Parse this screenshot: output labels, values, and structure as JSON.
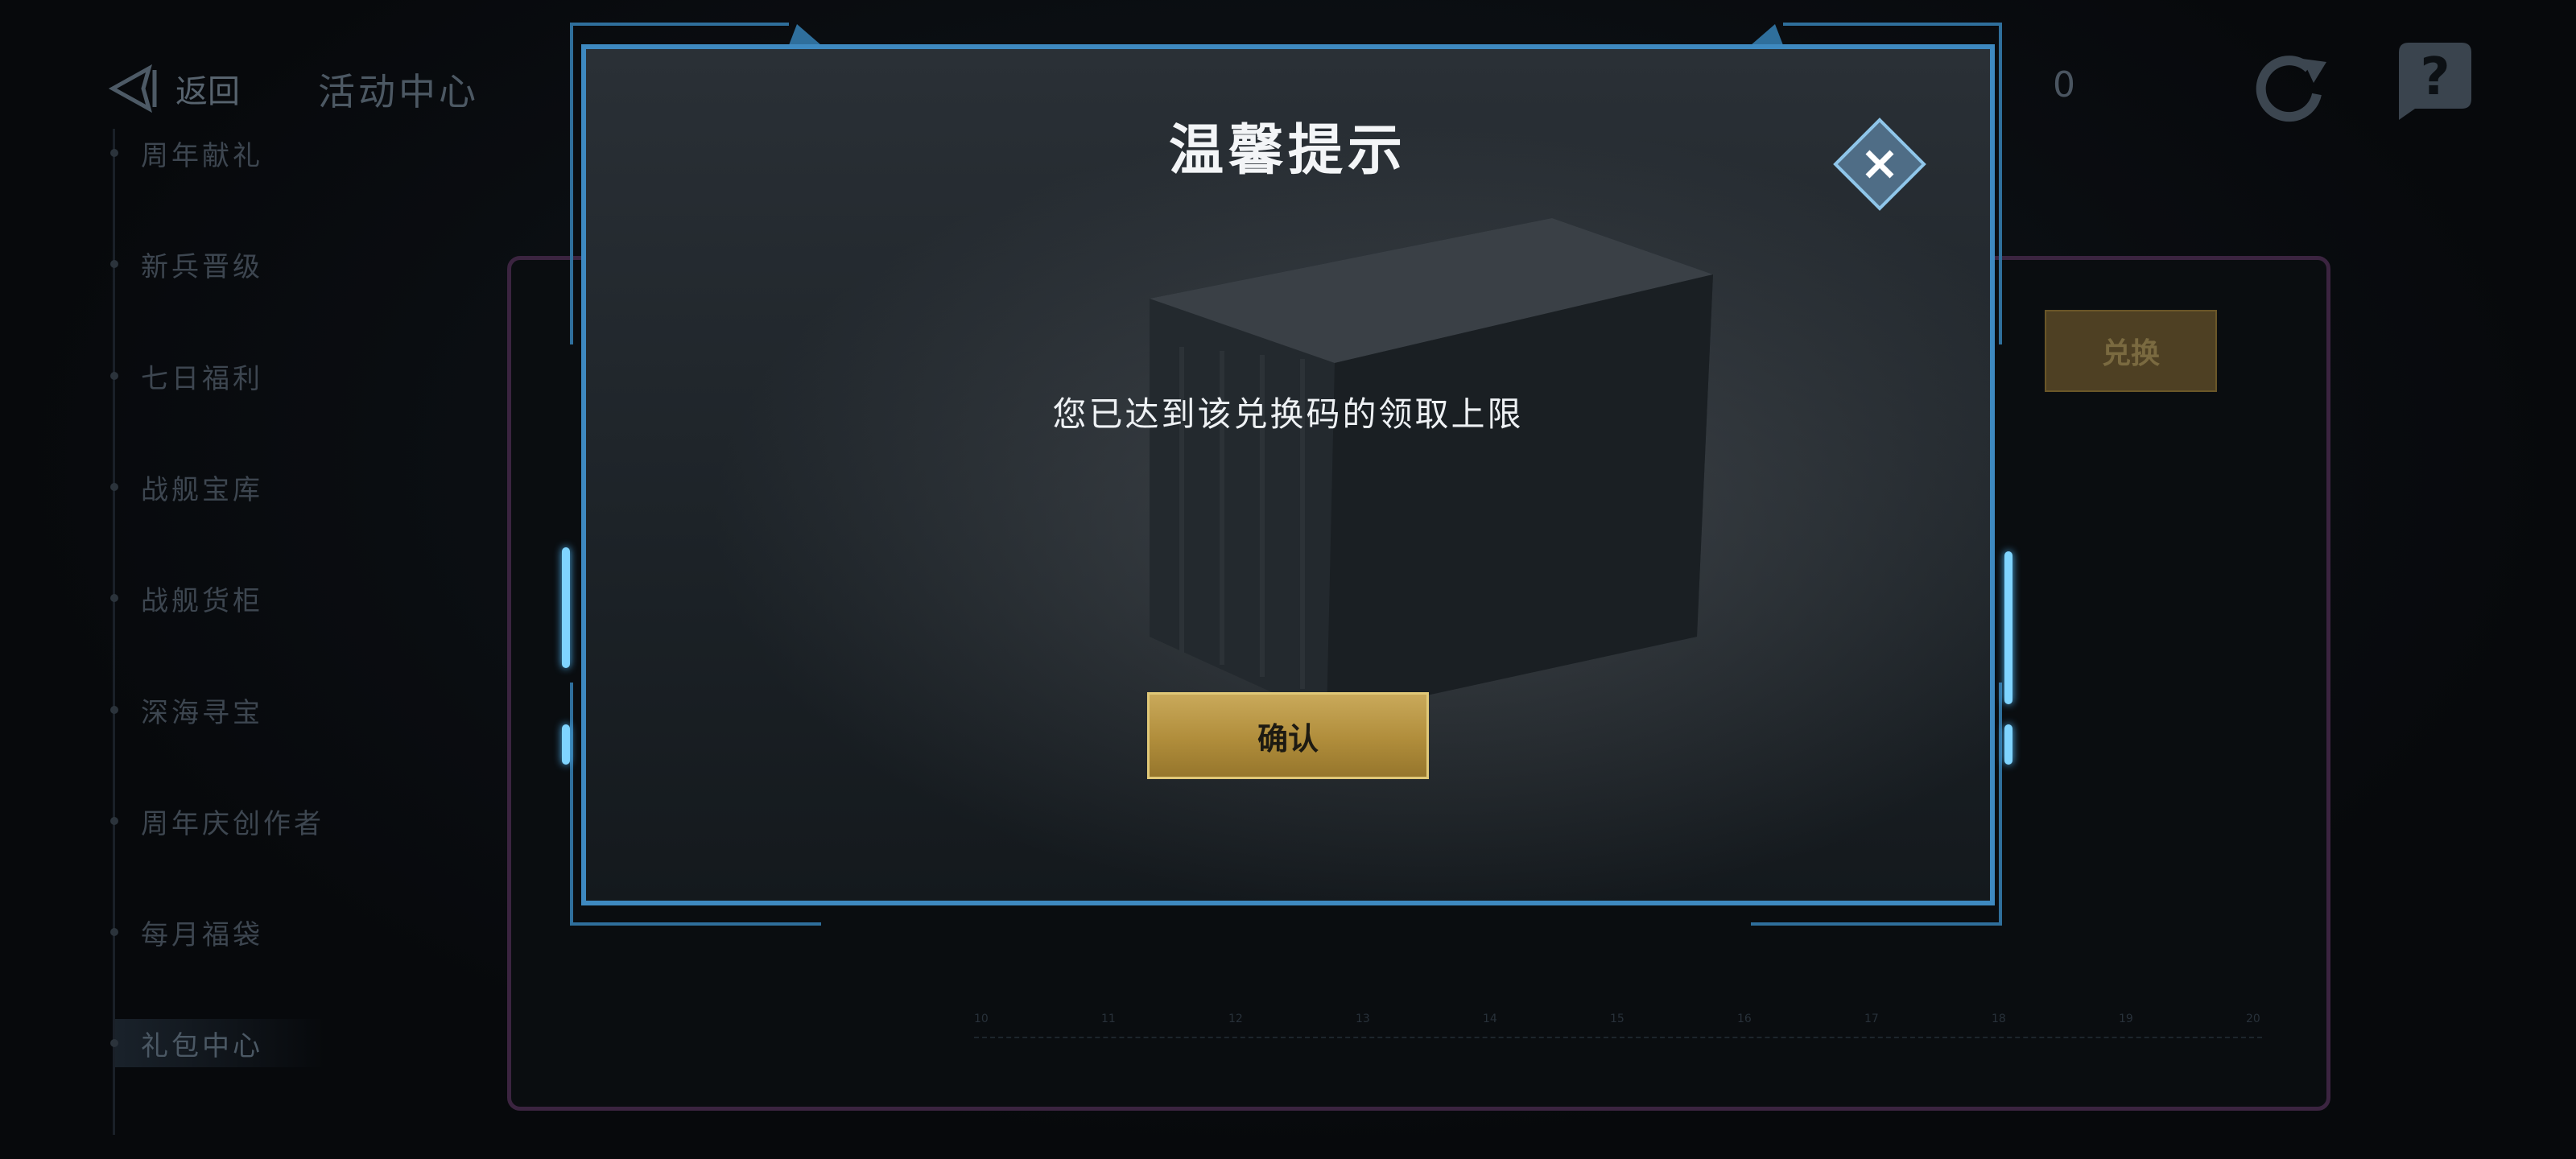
{
  "header": {
    "back_label": "返回",
    "page_title": "活动中心",
    "currency_value": "0"
  },
  "sidebar": {
    "items": [
      {
        "label": "周年献礼"
      },
      {
        "label": "新兵晋级"
      },
      {
        "label": "七日福利"
      },
      {
        "label": "战舰宝库"
      },
      {
        "label": "战舰货柜"
      },
      {
        "label": "深海寻宝"
      },
      {
        "label": "周年庆创作者"
      },
      {
        "label": "每月福袋"
      },
      {
        "label": "礼包中心"
      }
    ],
    "active_index": 8
  },
  "background_panel": {
    "exchange_label": "兑换",
    "ruler_ticks": [
      "10",
      "11",
      "12",
      "13",
      "14",
      "15",
      "16",
      "17",
      "18",
      "19",
      "20"
    ]
  },
  "modal": {
    "title": "温馨提示",
    "message": "您已达到该兑换码的领取上限",
    "confirm_label": "确认"
  },
  "colors": {
    "modal_border": "#3e89c0",
    "confirm_bg": "#b08d3b",
    "panel_border": "#3b2440"
  },
  "icons": {
    "back": "back-arrow-icon",
    "refresh": "refresh-icon",
    "help": "help-icon",
    "close": "close-icon"
  }
}
